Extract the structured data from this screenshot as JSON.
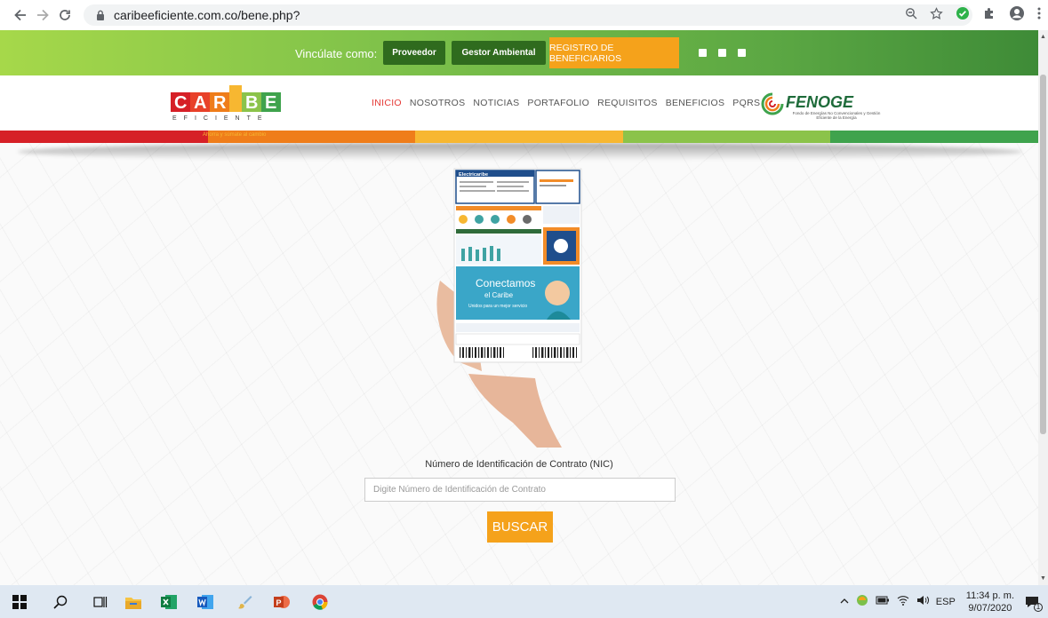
{
  "browser": {
    "url": "caribeeficiente.com.co/bene.php?",
    "icons": [
      "back-icon",
      "forward-icon",
      "reload-icon",
      "lock-icon",
      "zoom-icon",
      "star-icon",
      "extension-check-icon",
      "puzzle-icon",
      "profile-icon",
      "menu-dots-icon"
    ]
  },
  "topbar": {
    "vinculate": "Vincúlate como:",
    "proveedor": "Proveedor",
    "gestor": "Gestor Ambiental",
    "registro": "REGISTRO DE BENEFICIARIOS",
    "social": [
      "instagram-icon",
      "youtube-icon",
      "facebook-icon"
    ]
  },
  "header": {
    "logo_letters": "CAR BE",
    "logo_sub": "EFICIENTE",
    "logo_tagline": "Ahorra y súmate al cambio",
    "menu": [
      {
        "label": "INICIO",
        "active": true
      },
      {
        "label": "NOSOTROS"
      },
      {
        "label": "NOTICIAS"
      },
      {
        "label": "PORTAFOLIO"
      },
      {
        "label": "REQUISITOS"
      },
      {
        "label": "BENEFICIOS"
      },
      {
        "label": "PQRS"
      }
    ],
    "fenoge": "FENOGE",
    "fenoge_sub": "Fondo de Energías No Convencionales y Gestión Eficiente de la Energía"
  },
  "colors": {
    "band": [
      "#d62027",
      "#ef7d1a",
      "#f7b731",
      "#8bc34a",
      "#3fa34d"
    ],
    "green_dark": "#2f6b1e",
    "orange": "#f5a21b"
  },
  "bill": {
    "brand": "Electricaribe",
    "banner": "Conectamos",
    "banner2": "el Caribe",
    "banner3": "Unidos para un mejor servicio"
  },
  "form": {
    "label": "Número de Identificación de Contrato (NIC)",
    "placeholder": "Digite Número de Identificación de Contrato",
    "value": "",
    "button": "BUSCAR"
  },
  "taskbar": {
    "apps": [
      "windows-start-icon",
      "search-icon",
      "task-view-icon",
      "file-explorer-icon",
      "excel-icon",
      "word-icon",
      "paint-icon",
      "powerpoint-icon",
      "chrome-icon"
    ],
    "lang": "ESP",
    "time": "11:34 p. m.",
    "date": "9/07/2020",
    "notifications": "1"
  }
}
